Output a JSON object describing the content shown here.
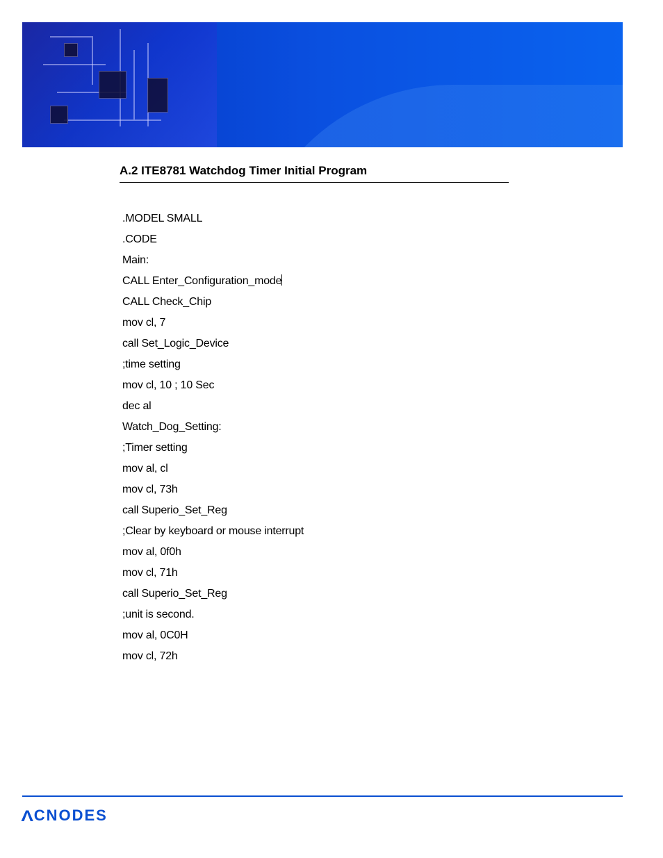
{
  "heading": "A.2 ITE8781 Watchdog Timer Initial Program",
  "code": {
    "lines": [
      ".MODEL SMALL",
      ".CODE",
      "Main:",
      "CALL Enter_Configuration_mode",
      "CALL Check_Chip",
      "mov cl, 7",
      "call Set_Logic_Device",
      ";time setting",
      "mov cl, 10 ; 10 Sec",
      "dec al",
      "Watch_Dog_Setting:",
      ";Timer setting",
      "mov al, cl",
      "mov cl, 73h",
      "call Superio_Set_Reg",
      ";Clear by keyboard or mouse interrupt",
      "mov al, 0f0h",
      "mov cl, 71h",
      "call Superio_Set_Reg",
      ";unit is second.",
      "mov al, 0C0H",
      "mov cl, 72h"
    ],
    "cursor_after_line_index": 3
  },
  "footer": {
    "logo_text": "CNODES",
    "brand_caret": "Λ"
  }
}
